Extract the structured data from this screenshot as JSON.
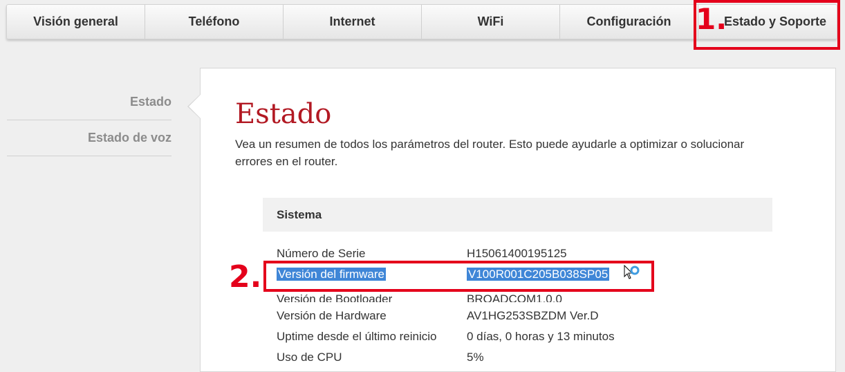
{
  "tabs": [
    {
      "label": "Visión general"
    },
    {
      "label": "Teléfono"
    },
    {
      "label": "Internet"
    },
    {
      "label": "WiFi"
    },
    {
      "label": "Configuración"
    },
    {
      "label": "Estado y Soporte"
    }
  ],
  "annotations": {
    "one": "1.",
    "two": "2.",
    "color": "#e4001b"
  },
  "sidebar": {
    "items": [
      {
        "label": "Estado"
      },
      {
        "label": "Estado de voz"
      }
    ]
  },
  "main": {
    "title": "Estado",
    "description": "Vea un resumen de todos los parámetros del router. Esto puede ayudarle a optimizar o solucionar errores en el router.",
    "section": "Sistema",
    "rows": [
      {
        "label": "Número de Serie",
        "value": "H15061400195125"
      },
      {
        "label": "Versión del firmware",
        "value": "V100R001C205B038SP05"
      },
      {
        "label": "Versión de Bootloader",
        "value": "BROADCOM1.0.0"
      },
      {
        "label": "Versión de Hardware",
        "value": "AV1HG253SBZDM Ver.D"
      },
      {
        "label": "Uptime desde el último reinicio",
        "value": "0 días, 0 horas y 13 minutos"
      },
      {
        "label": "Uso de CPU",
        "value": "5%"
      }
    ]
  },
  "colors": {
    "accent": "#b21923",
    "selection": "#3f86d7"
  },
  "icons": [
    "mouse-cursor-icon",
    "busy-indicator-icon"
  ]
}
